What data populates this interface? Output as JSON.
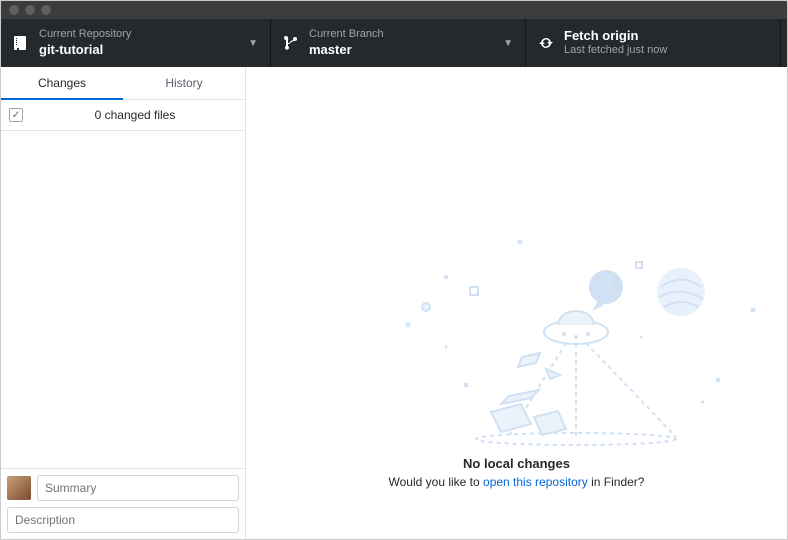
{
  "toolbar": {
    "repo": {
      "label": "Current Repository",
      "value": "git-tutorial"
    },
    "branch": {
      "label": "Current Branch",
      "value": "master"
    },
    "fetch": {
      "label": "Fetch origin",
      "status": "Last fetched just now"
    }
  },
  "sidebar": {
    "tabs": [
      "Changes",
      "History"
    ],
    "changes_header": "0 changed files"
  },
  "commit": {
    "summary_placeholder": "Summary",
    "description_placeholder": "Description"
  },
  "main": {
    "empty_title": "No local changes",
    "empty_sub_prefix": "Would you like to ",
    "empty_link": "open this repository",
    "empty_sub_suffix": " in Finder?"
  }
}
